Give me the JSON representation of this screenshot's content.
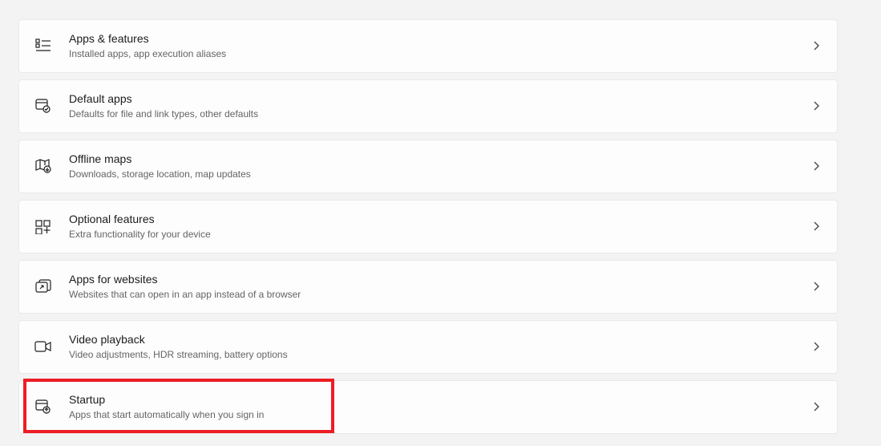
{
  "settings": {
    "items": [
      {
        "id": "apps-features",
        "title": "Apps & features",
        "subtitle": "Installed apps, app execution aliases",
        "icon": "apps-list-icon"
      },
      {
        "id": "default-apps",
        "title": "Default apps",
        "subtitle": "Defaults for file and link types, other defaults",
        "icon": "default-apps-icon"
      },
      {
        "id": "offline-maps",
        "title": "Offline maps",
        "subtitle": "Downloads, storage location, map updates",
        "icon": "map-icon"
      },
      {
        "id": "optional-features",
        "title": "Optional features",
        "subtitle": "Extra functionality for your device",
        "icon": "optional-features-icon"
      },
      {
        "id": "apps-websites",
        "title": "Apps for websites",
        "subtitle": "Websites that can open in an app instead of a browser",
        "icon": "websites-icon"
      },
      {
        "id": "video-playback",
        "title": "Video playback",
        "subtitle": "Video adjustments, HDR streaming, battery options",
        "icon": "video-icon"
      },
      {
        "id": "startup",
        "title": "Startup",
        "subtitle": "Apps that start automatically when you sign in",
        "icon": "startup-icon",
        "highlighted": true
      }
    ]
  }
}
